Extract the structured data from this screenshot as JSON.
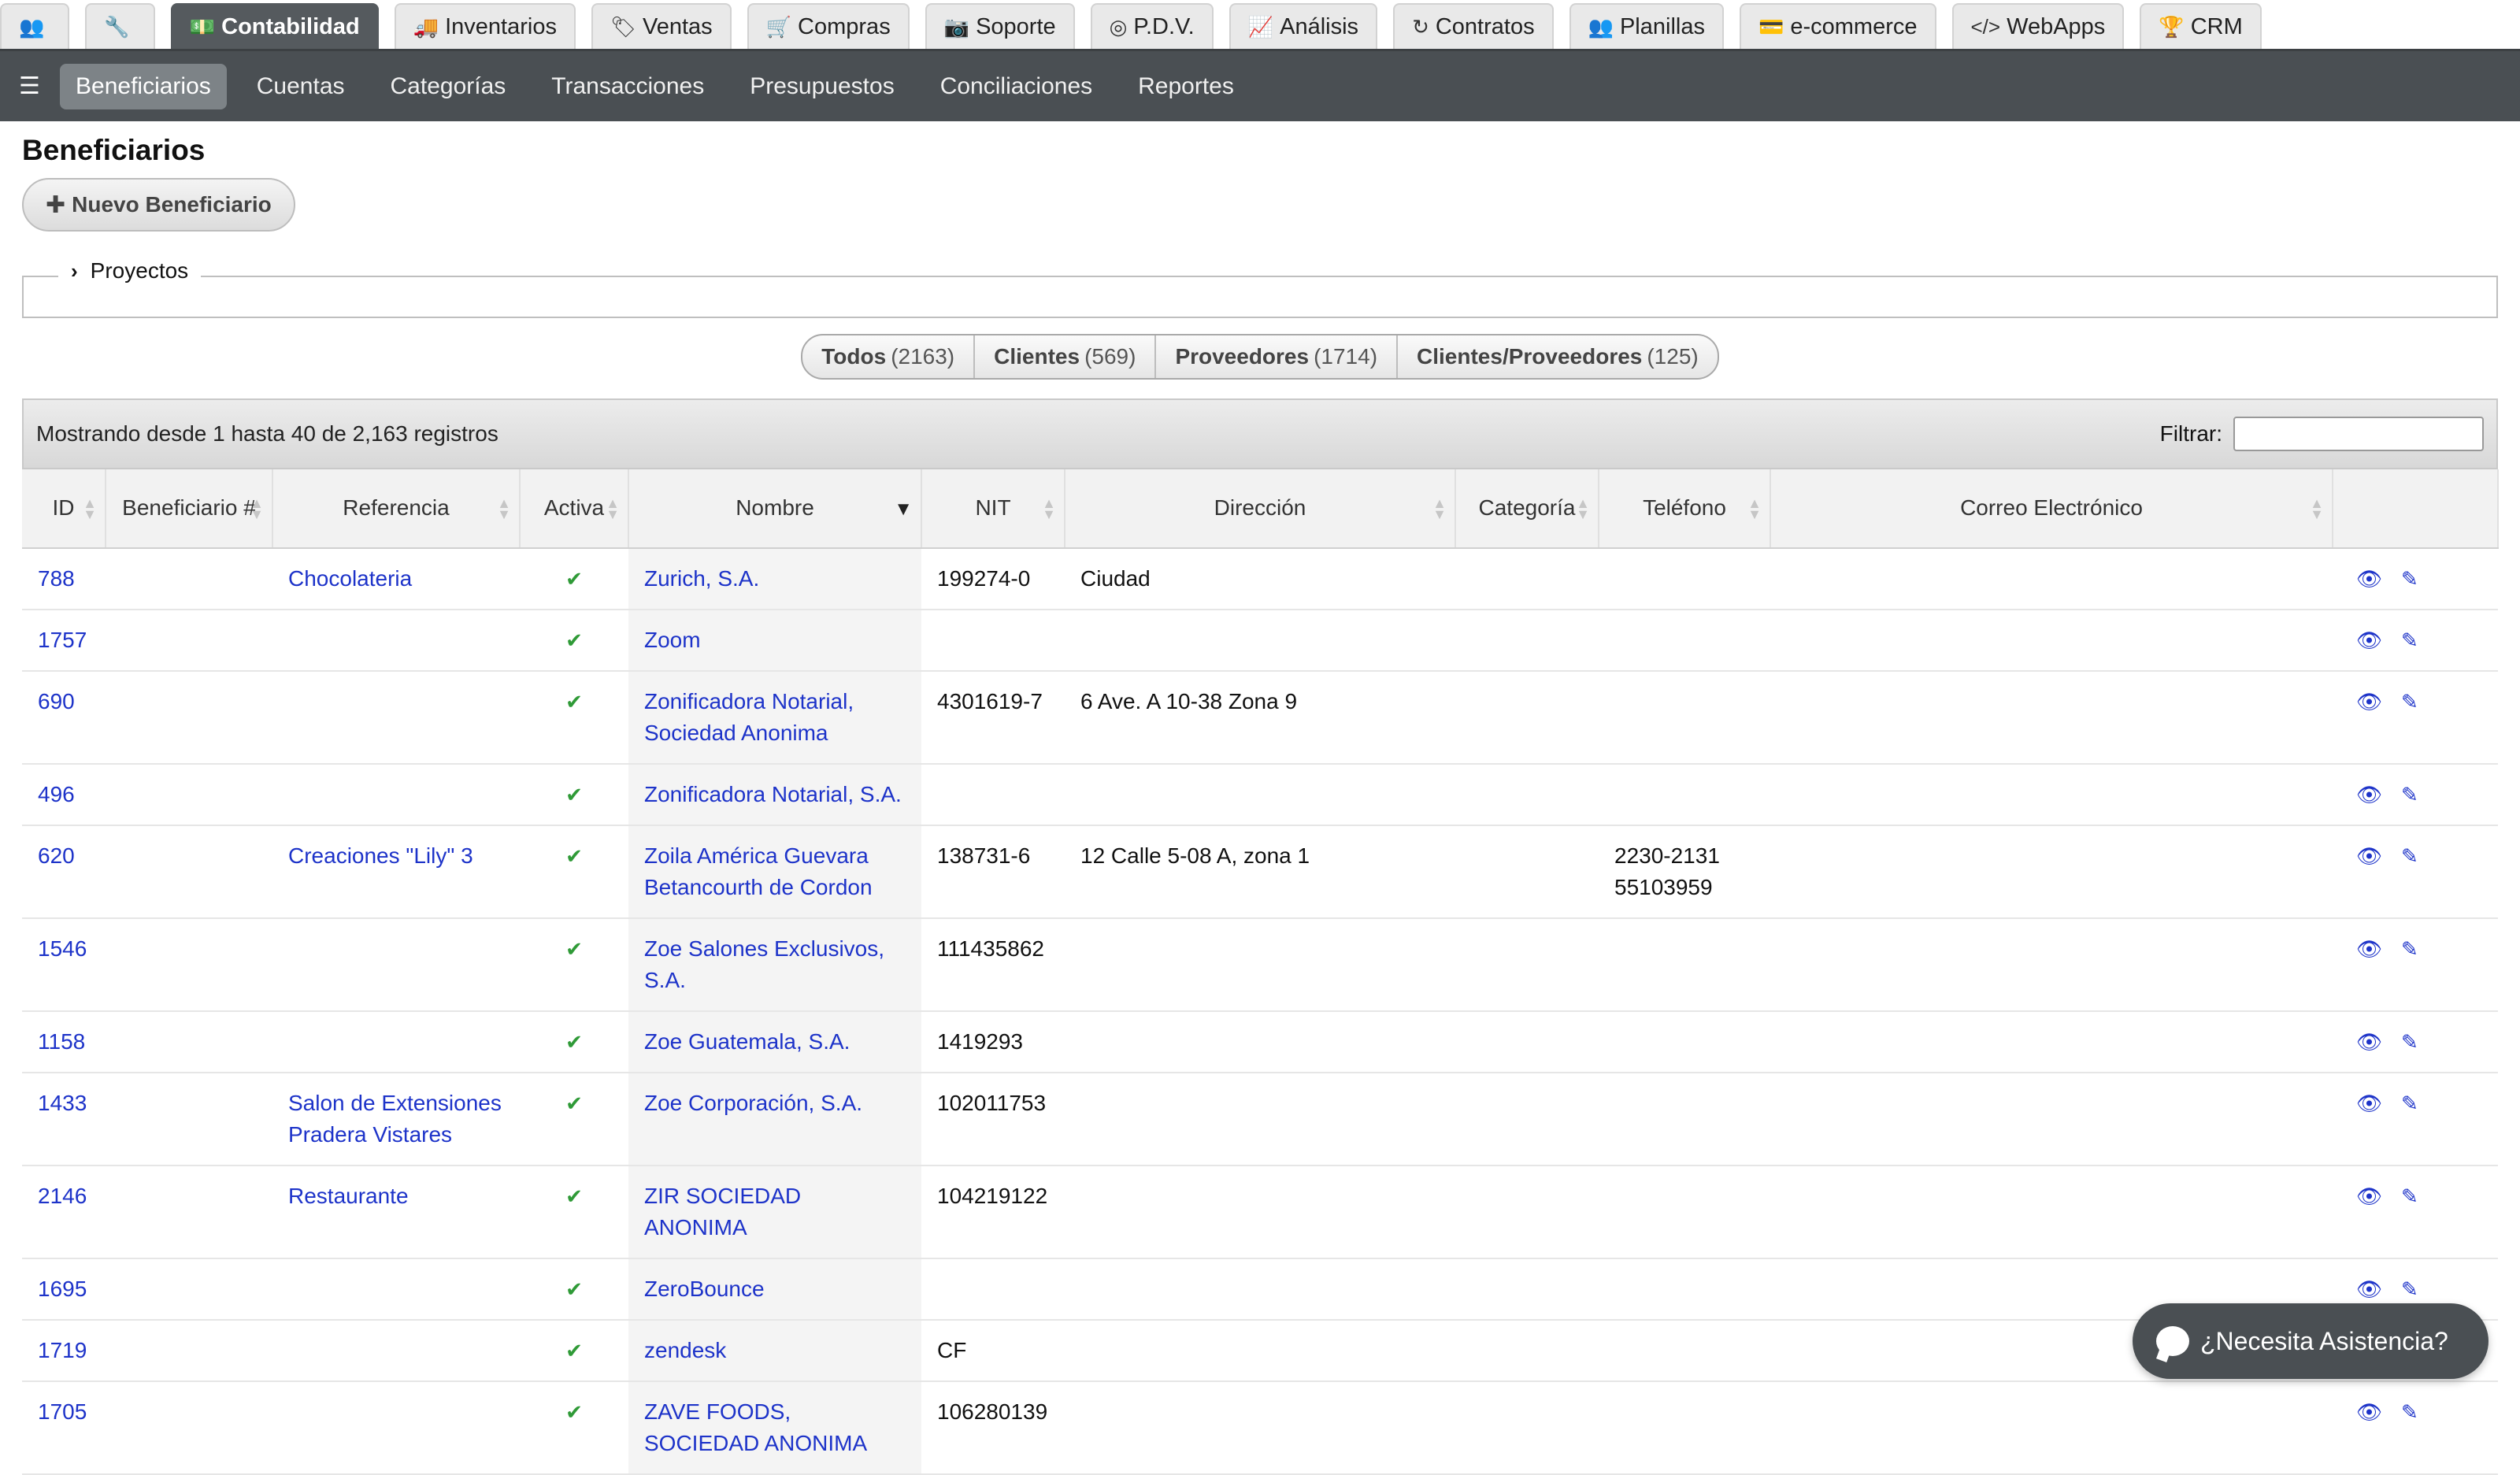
{
  "top_tabs": [
    {
      "icon": "👥",
      "icon_name": "users-icon",
      "label": "",
      "active": false
    },
    {
      "icon": "🔧",
      "icon_name": "wrench-icon",
      "label": "",
      "active": false
    },
    {
      "icon": "💵",
      "icon_name": "money-icon",
      "label": "Contabilidad",
      "active": true
    },
    {
      "icon": "🚚",
      "icon_name": "truck-icon",
      "label": "Inventarios",
      "active": false
    },
    {
      "icon": "🏷",
      "icon_name": "tags-icon",
      "label": "Ventas",
      "active": false
    },
    {
      "icon": "🛒",
      "icon_name": "cart-icon",
      "label": "Compras",
      "active": false
    },
    {
      "icon": "📷",
      "icon_name": "camera-icon",
      "label": "Soporte",
      "active": false
    },
    {
      "icon": "◎",
      "icon_name": "pos-icon",
      "label": "P.D.V.",
      "active": false
    },
    {
      "icon": "📈",
      "icon_name": "chart-icon",
      "label": "Análisis",
      "active": false
    },
    {
      "icon": "↻",
      "icon_name": "refresh-icon",
      "label": "Contratos",
      "active": false
    },
    {
      "icon": "👥",
      "icon_name": "group-icon",
      "label": "Planillas",
      "active": false
    },
    {
      "icon": "💳",
      "icon_name": "credit-card-icon",
      "label": "e-commerce",
      "active": false
    },
    {
      "icon": "</>",
      "icon_name": "code-icon",
      "label": "WebApps",
      "active": false
    },
    {
      "icon": "🏆",
      "icon_name": "trophy-icon",
      "label": "CRM",
      "active": false
    }
  ],
  "subnav": {
    "settings_icon": "☰",
    "items": [
      {
        "label": "Beneficiarios",
        "active": true
      },
      {
        "label": "Cuentas",
        "active": false
      },
      {
        "label": "Categorías",
        "active": false
      },
      {
        "label": "Transacciones",
        "active": false
      },
      {
        "label": "Presupuestos",
        "active": false
      },
      {
        "label": "Conciliaciones",
        "active": false
      },
      {
        "label": "Reportes",
        "active": false
      }
    ]
  },
  "page": {
    "title": "Beneficiarios",
    "new_button": "Nuevo Beneficiario",
    "projects_label": "Proyectos"
  },
  "segments": [
    {
      "label": "Todos",
      "count": "(2163)"
    },
    {
      "label": "Clientes",
      "count": "(569)"
    },
    {
      "label": "Proveedores",
      "count": "(1714)"
    },
    {
      "label": "Clientes/Proveedores",
      "count": "(125)"
    }
  ],
  "table_bar": {
    "info": "Mostrando desde 1 hasta 40 de 2,163 registros",
    "filter_label": "Filtrar:",
    "filter_value": ""
  },
  "columns": [
    {
      "label": "ID"
    },
    {
      "label": "Beneficiario #"
    },
    {
      "label": "Referencia"
    },
    {
      "label": "Activa"
    },
    {
      "label": "Nombre",
      "sorted": true
    },
    {
      "label": "NIT"
    },
    {
      "label": "Dirección"
    },
    {
      "label": "Categoría"
    },
    {
      "label": "Teléfono"
    },
    {
      "label": "Correo Electrónico"
    },
    {
      "label": ""
    }
  ],
  "rows": [
    {
      "id": "788",
      "num": "",
      "ref": "Chocolateria",
      "active": true,
      "name": "Zurich, S.A.",
      "nit": "199274-0",
      "dir": "Ciudad",
      "cat": "",
      "tel": "",
      "mail": ""
    },
    {
      "id": "1757",
      "num": "",
      "ref": "",
      "active": true,
      "name": "Zoom",
      "nit": "",
      "dir": "",
      "cat": "",
      "tel": "",
      "mail": ""
    },
    {
      "id": "690",
      "num": "",
      "ref": "",
      "active": true,
      "name": "Zonificadora Notarial, Sociedad Anonima",
      "nit": "4301619-7",
      "dir": "6 Ave. A 10-38 Zona 9",
      "cat": "",
      "tel": "",
      "mail": ""
    },
    {
      "id": "496",
      "num": "",
      "ref": "",
      "active": true,
      "name": "Zonificadora Notarial, S.A.",
      "nit": "",
      "dir": "",
      "cat": "",
      "tel": "",
      "mail": ""
    },
    {
      "id": "620",
      "num": "",
      "ref": "Creaciones \"Lily\" 3",
      "active": true,
      "name": "Zoila América Guevara Betancourth de Cordon",
      "nit": "138731-6",
      "dir": "12 Calle 5-08 A, zona 1",
      "cat": "",
      "tel": "2230-2131 55103959",
      "mail": ""
    },
    {
      "id": "1546",
      "num": "",
      "ref": "",
      "active": true,
      "name": "Zoe Salones Exclusivos, S.A.",
      "nit": "111435862",
      "dir": "",
      "cat": "",
      "tel": "",
      "mail": ""
    },
    {
      "id": "1158",
      "num": "",
      "ref": "",
      "active": true,
      "name": "Zoe Guatemala, S.A.",
      "nit": "1419293",
      "dir": "",
      "cat": "",
      "tel": "",
      "mail": ""
    },
    {
      "id": "1433",
      "num": "",
      "ref": "Salon de Extensiones Pradera Vistares",
      "active": true,
      "name": "Zoe Corporación, S.A.",
      "nit": "102011753",
      "dir": "",
      "cat": "",
      "tel": "",
      "mail": ""
    },
    {
      "id": "2146",
      "num": "",
      "ref": "Restaurante",
      "active": true,
      "name": "ZIR SOCIEDAD ANONIMA",
      "nit": "104219122",
      "dir": "",
      "cat": "",
      "tel": "",
      "mail": ""
    },
    {
      "id": "1695",
      "num": "",
      "ref": "",
      "active": true,
      "name": "ZeroBounce",
      "nit": "",
      "dir": "",
      "cat": "",
      "tel": "",
      "mail": ""
    },
    {
      "id": "1719",
      "num": "",
      "ref": "",
      "active": true,
      "name": "zendesk",
      "nit": "CF",
      "dir": "",
      "cat": "",
      "tel": "",
      "mail": ""
    },
    {
      "id": "1705",
      "num": "",
      "ref": "",
      "active": true,
      "name": "ZAVE FOODS, SOCIEDAD ANONIMA",
      "nit": "106280139",
      "dir": "",
      "cat": "",
      "tel": "",
      "mail": ""
    }
  ],
  "icons": {
    "check": "✔",
    "view": "👁",
    "edit": "✎",
    "plus": "✚",
    "chevron": "›"
  },
  "help": {
    "label": "¿Necesita Asistencia?"
  },
  "colors": {
    "link": "#1d33c9",
    "check": "#2f9a37",
    "nav": "#4a4f53",
    "active_tab": "#555a5e"
  }
}
